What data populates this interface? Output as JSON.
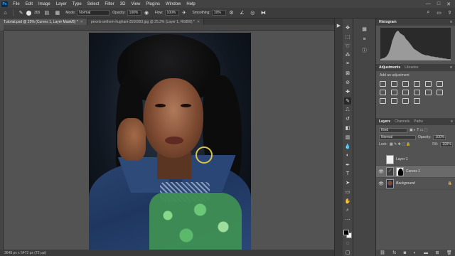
{
  "menubar": {
    "logo": "Ps",
    "items": [
      "File",
      "Edit",
      "Image",
      "Layer",
      "Type",
      "Select",
      "Filter",
      "3D",
      "View",
      "Plugins",
      "Window",
      "Help"
    ],
    "controls": [
      "—",
      "□",
      "✕"
    ]
  },
  "options": {
    "brush_size": "300",
    "mode_label": "Mode:",
    "mode_value": "Normal",
    "opacity_label": "Opacity:",
    "opacity_value": "100%",
    "flow_label": "Flow:",
    "flow_value": "100%",
    "smoothing_label": "Smoothing:",
    "smoothing_value": "10%"
  },
  "tabs": [
    {
      "label": "Tutorial.psd @ 25% (Curves 1, Layer Mask/8) *",
      "active": true
    },
    {
      "label": "pexels-anthem-hughani-3556993.jpg @ 25.2% (Layer 1, RGB/8) *",
      "active": false
    }
  ],
  "status": {
    "text": "3648 px x 5472 px (72 ppi)"
  },
  "panels": {
    "histogram_tab": "Histogram",
    "adjustments_tab": "Adjustments",
    "libraries_tab": "Libraries",
    "add_adjustment": "Add an adjustment",
    "layers_tab": "Layers",
    "channels_tab": "Channels",
    "paths_tab": "Paths"
  },
  "layers_panel": {
    "kind_label": "Kind",
    "blend_mode": "Normal",
    "opacity_label": "Opacity:",
    "opacity_value": "100%",
    "lock_label": "Lock:",
    "fill_label": "Fill:",
    "fill_value": "100%",
    "layers": [
      {
        "name": "Layer 1"
      },
      {
        "name": "Curves 1"
      },
      {
        "name": "Background"
      }
    ],
    "footer_icons": [
      "link-icon",
      "fx-icon",
      "mask-icon",
      "adjustment-icon",
      "folder-icon",
      "new-layer-icon",
      "trash-icon"
    ]
  },
  "histogram": {
    "values": [
      2,
      3,
      4,
      6,
      10,
      18,
      30,
      38,
      44,
      46,
      42,
      40,
      38,
      33,
      30,
      26,
      22,
      18,
      16,
      14,
      12,
      10,
      9,
      8,
      8,
      7,
      6,
      6,
      5,
      5,
      4,
      4,
      3,
      3,
      2,
      2,
      2
    ]
  }
}
